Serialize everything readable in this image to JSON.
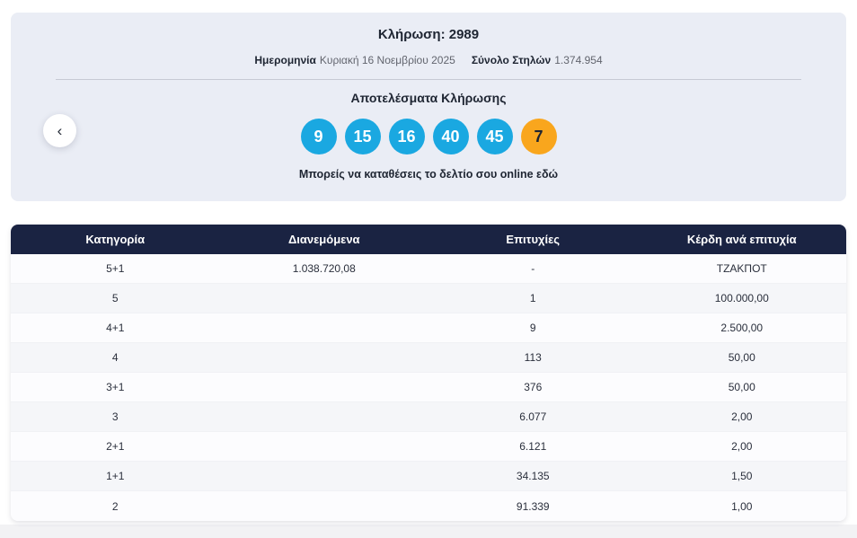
{
  "hero": {
    "title": "Κλήρωση: 2989",
    "date_label": "Ημερομηνία",
    "date_value": "Κυριακή 16 Νοεμβρίου 2025",
    "columns_label": "Σύνολο Στηλών",
    "columns_value": "1.374.954",
    "results_title": "Αποτελέσματα Κλήρωσης",
    "numbers": [
      {
        "value": "9",
        "type": "main"
      },
      {
        "value": "15",
        "type": "main"
      },
      {
        "value": "16",
        "type": "main"
      },
      {
        "value": "40",
        "type": "main"
      },
      {
        "value": "45",
        "type": "main"
      },
      {
        "value": "7",
        "type": "bonus"
      }
    ],
    "caption": "Μπορείς να καταθέσεις το δελτίο σου online εδώ",
    "prev_button_glyph": "‹"
  },
  "colors": {
    "main_ball": "#1aa8e1",
    "bonus_ball": "#f9a61d",
    "header_bg": "#1a2342",
    "hero_bg": "#eaedf5"
  },
  "table": {
    "headers": [
      "Κατηγορία",
      "Διανεμόμενα",
      "Επιτυχίες",
      "Κέρδη ανά επιτυχία"
    ],
    "rows": [
      [
        "5+1",
        "1.038.720,08",
        "-",
        "ΤΖΑΚΠΟΤ"
      ],
      [
        "5",
        "",
        "1",
        "100.000,00"
      ],
      [
        "4+1",
        "",
        "9",
        "2.500,00"
      ],
      [
        "4",
        "",
        "113",
        "50,00"
      ],
      [
        "3+1",
        "",
        "376",
        "50,00"
      ],
      [
        "3",
        "",
        "6.077",
        "2,00"
      ],
      [
        "2+1",
        "",
        "6.121",
        "2,00"
      ],
      [
        "1+1",
        "",
        "34.135",
        "1,50"
      ],
      [
        "2",
        "",
        "91.339",
        "1,00"
      ]
    ]
  }
}
